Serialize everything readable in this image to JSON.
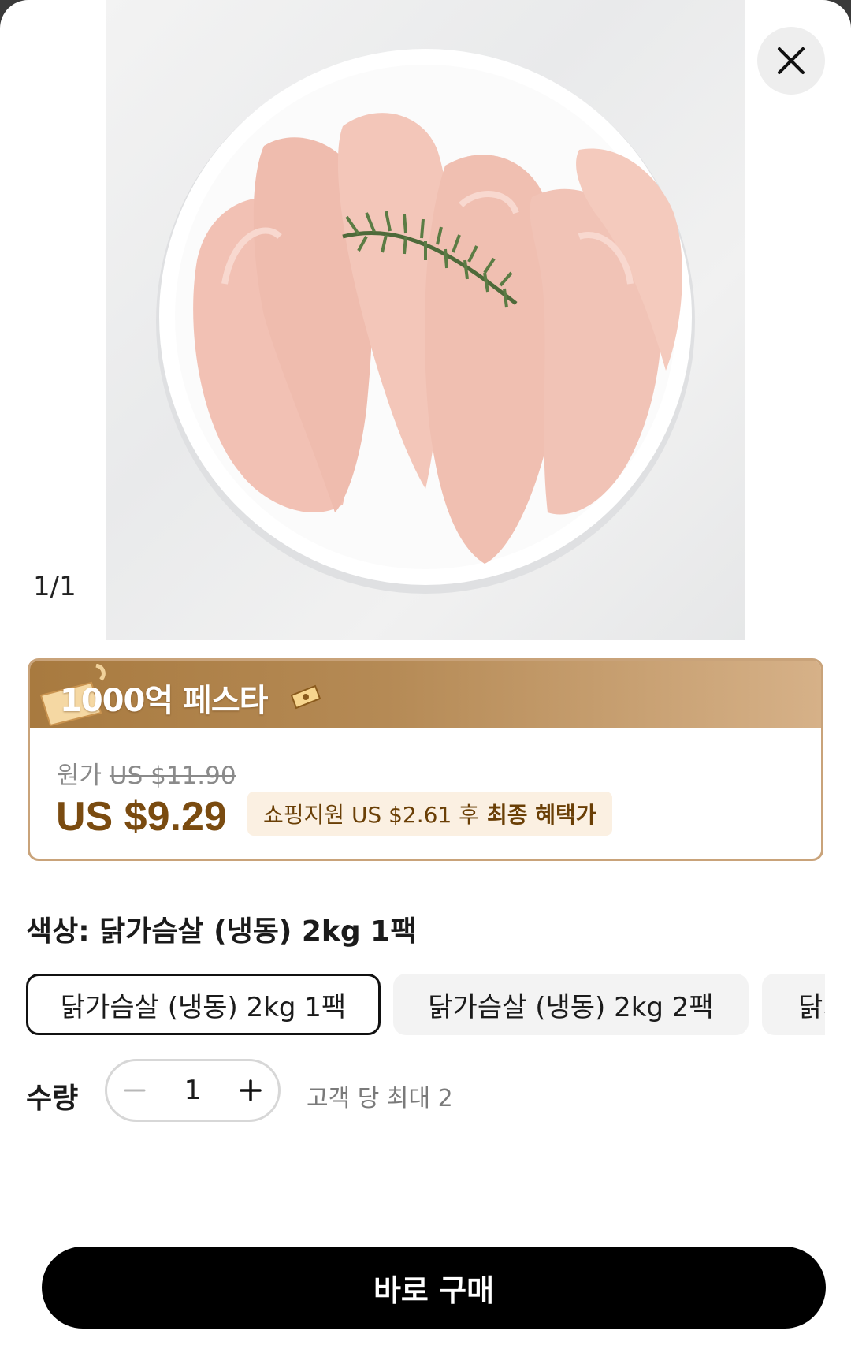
{
  "gallery": {
    "counter": "1/1",
    "image_icon": "product-photo"
  },
  "promo": {
    "fest_title": "1000억 페스타",
    "original_label": "원가",
    "original_price": "US $11.90",
    "final_price": "US $9.29",
    "benefit_text": "쇼핑지원 US $2.61 후",
    "benefit_emphasis": "최종 혜택가"
  },
  "options": {
    "label": "색상: 닭가슴살 (냉동) 2kg 1팩",
    "items": [
      {
        "label": "닭가슴살 (냉동) 2kg 1팩",
        "selected": true
      },
      {
        "label": "닭가슴살 (냉동) 2kg 2팩",
        "selected": false
      },
      {
        "label": "닭가",
        "selected": false
      }
    ]
  },
  "quantity": {
    "label": "수량",
    "value": "1",
    "limit_note": "고객 당 최대 2"
  },
  "buy_button": "바로 구매",
  "colors": {
    "price_brown": "#7a4b10",
    "banner_gold": "#b58a55",
    "button_black": "#000000"
  }
}
